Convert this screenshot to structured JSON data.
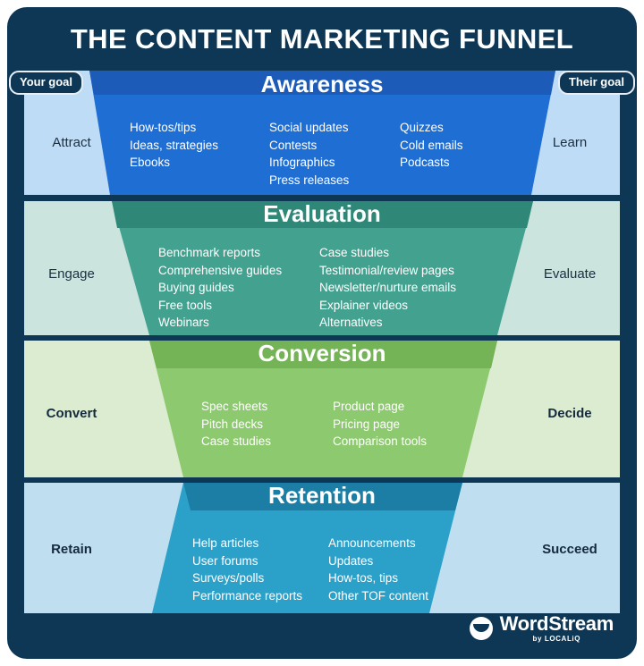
{
  "page": {
    "title": "THE CONTENT MARKETING FUNNEL",
    "colors": {
      "card_bg": "#0d3754",
      "awareness_header": "#1c5cb8",
      "awareness_body": "#1f6ed4",
      "awareness_side": "#bfdcf7",
      "evaluation_header": "#2f8778",
      "evaluation_body": "#43a18f",
      "evaluation_side": "#cbe4dd",
      "conversion_header": "#74b356",
      "conversion_body": "#8dc96e",
      "conversion_side": "#dcecd0",
      "retention_header": "#1c7ea4",
      "retention_body": "#2ba0c9",
      "retention_side": "#bfdff1"
    }
  },
  "badges": {
    "left": "Your goal",
    "right": "Their goal"
  },
  "stages": [
    {
      "name": "Awareness",
      "left_goal": "Attract",
      "right_goal": "Learn",
      "columns": [
        [
          "How-tos/tips",
          "Ideas, strategies",
          "Ebooks"
        ],
        [
          "Social updates",
          "Contests",
          "Infographics",
          "Press releases"
        ],
        [
          "Quizzes",
          "Cold emails",
          "Podcasts"
        ]
      ]
    },
    {
      "name": "Evaluation",
      "left_goal": "Engage",
      "right_goal": "Evaluate",
      "columns": [
        [
          "Benchmark reports",
          "Comprehensive guides",
          "Buying guides",
          "Free tools",
          "Webinars"
        ],
        [
          "Case studies",
          "Testimonial/review pages",
          "Newsletter/nurture emails",
          "Explainer videos",
          "Alternatives"
        ]
      ]
    },
    {
      "name": "Conversion",
      "left_goal": "Convert",
      "right_goal": "Decide",
      "columns": [
        [
          "Spec sheets",
          "Pitch decks",
          "Case studies"
        ],
        [
          "Product page",
          "Pricing page",
          "Comparison tools"
        ]
      ]
    },
    {
      "name": "Retention",
      "left_goal": "Retain",
      "right_goal": "Succeed",
      "columns": [
        [
          "Help articles",
          "User forums",
          "Surveys/polls",
          "Performance reports"
        ],
        [
          "Announcements",
          "Updates",
          "How-tos, tips",
          "Other TOF content"
        ]
      ]
    }
  ],
  "logo": {
    "name": "WordStream",
    "tagline": "by LOCALiQ"
  }
}
